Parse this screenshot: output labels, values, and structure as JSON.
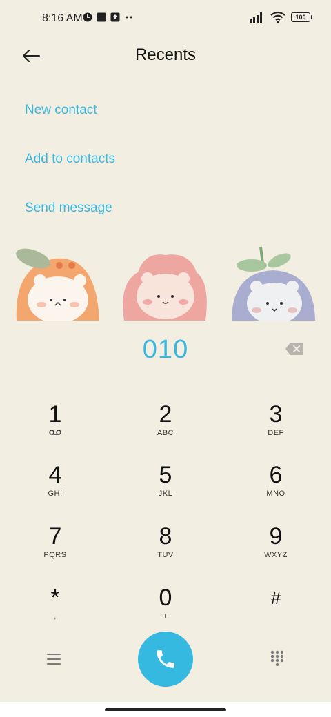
{
  "status_bar": {
    "time": "8:16 AM",
    "battery": "100",
    "icons": [
      "app-notification-icon",
      "square-notification-icon",
      "upload-notification-icon",
      "more-dots-icon",
      "signal-icon",
      "wifi-icon",
      "battery-icon"
    ]
  },
  "header": {
    "title": "Recents",
    "back_icon": "back-arrow-icon"
  },
  "actions": {
    "new_contact": "New contact",
    "add_to_contacts": "Add to contacts",
    "send_message": "Send message"
  },
  "dialer": {
    "number": "010",
    "backspace_icon": "backspace-icon"
  },
  "keypad": [
    {
      "digit": "1",
      "letters": ""
    },
    {
      "digit": "2",
      "letters": "ABC"
    },
    {
      "digit": "3",
      "letters": "DEF"
    },
    {
      "digit": "4",
      "letters": "GHI"
    },
    {
      "digit": "5",
      "letters": "JKL"
    },
    {
      "digit": "6",
      "letters": "MNO"
    },
    {
      "digit": "7",
      "letters": "PQRS"
    },
    {
      "digit": "8",
      "letters": "TUV"
    },
    {
      "digit": "9",
      "letters": "WXYZ"
    },
    {
      "digit": "*",
      "letters": ","
    },
    {
      "digit": "0",
      "letters": "+"
    },
    {
      "digit": "#",
      "letters": ""
    }
  ],
  "bottom_bar": {
    "menu_icon": "menu-icon",
    "call_icon": "phone-icon",
    "keypad_icon": "dialpad-icon"
  },
  "colors": {
    "accent": "#3ab7de",
    "background": "#f3eee2",
    "call_button": "#35b9e1"
  }
}
